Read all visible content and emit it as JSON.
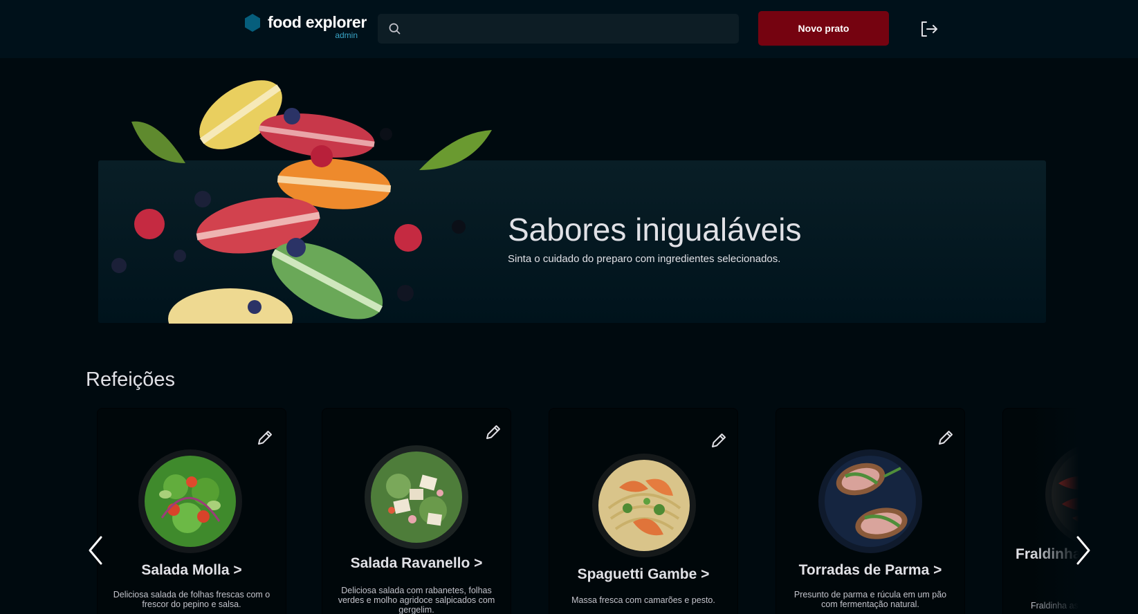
{
  "header": {
    "brand_name": "food explorer",
    "brand_role": "admin",
    "search_placeholder": "",
    "new_dish_label": "Novo prato",
    "accent_color": "#750310",
    "logo_color": "#065e7c"
  },
  "banner": {
    "title": "Sabores inigualáveis",
    "subtitle": "Sinta o cuidado do preparo com ingredientes selecionados."
  },
  "section": {
    "title": "Refeições"
  },
  "dishes": [
    {
      "name": "Salada Molla >",
      "description": "Deliciosa salada de folhas frescas com o frescor do pepino e salsa."
    },
    {
      "name": "Salada Ravanello >",
      "description": "Deliciosa salada com rabanetes, folhas verdes e molho agridoce salpicados com gergelim."
    },
    {
      "name": "Spaguetti Gambe >",
      "description": "Massa fresca com camarões e pesto."
    },
    {
      "name": "Torradas de Parma >",
      "description": "Presunto de parma e rúcula em um pão com fermentação natural."
    },
    {
      "name": "Fraldinha mo",
      "description": "Fraldinha as"
    }
  ],
  "icons": {
    "logo": "hexagon-icon",
    "search": "search-icon",
    "signout": "sign-out-icon",
    "edit": "pencil-icon",
    "prev": "chevron-left-icon",
    "next": "chevron-right-icon"
  }
}
